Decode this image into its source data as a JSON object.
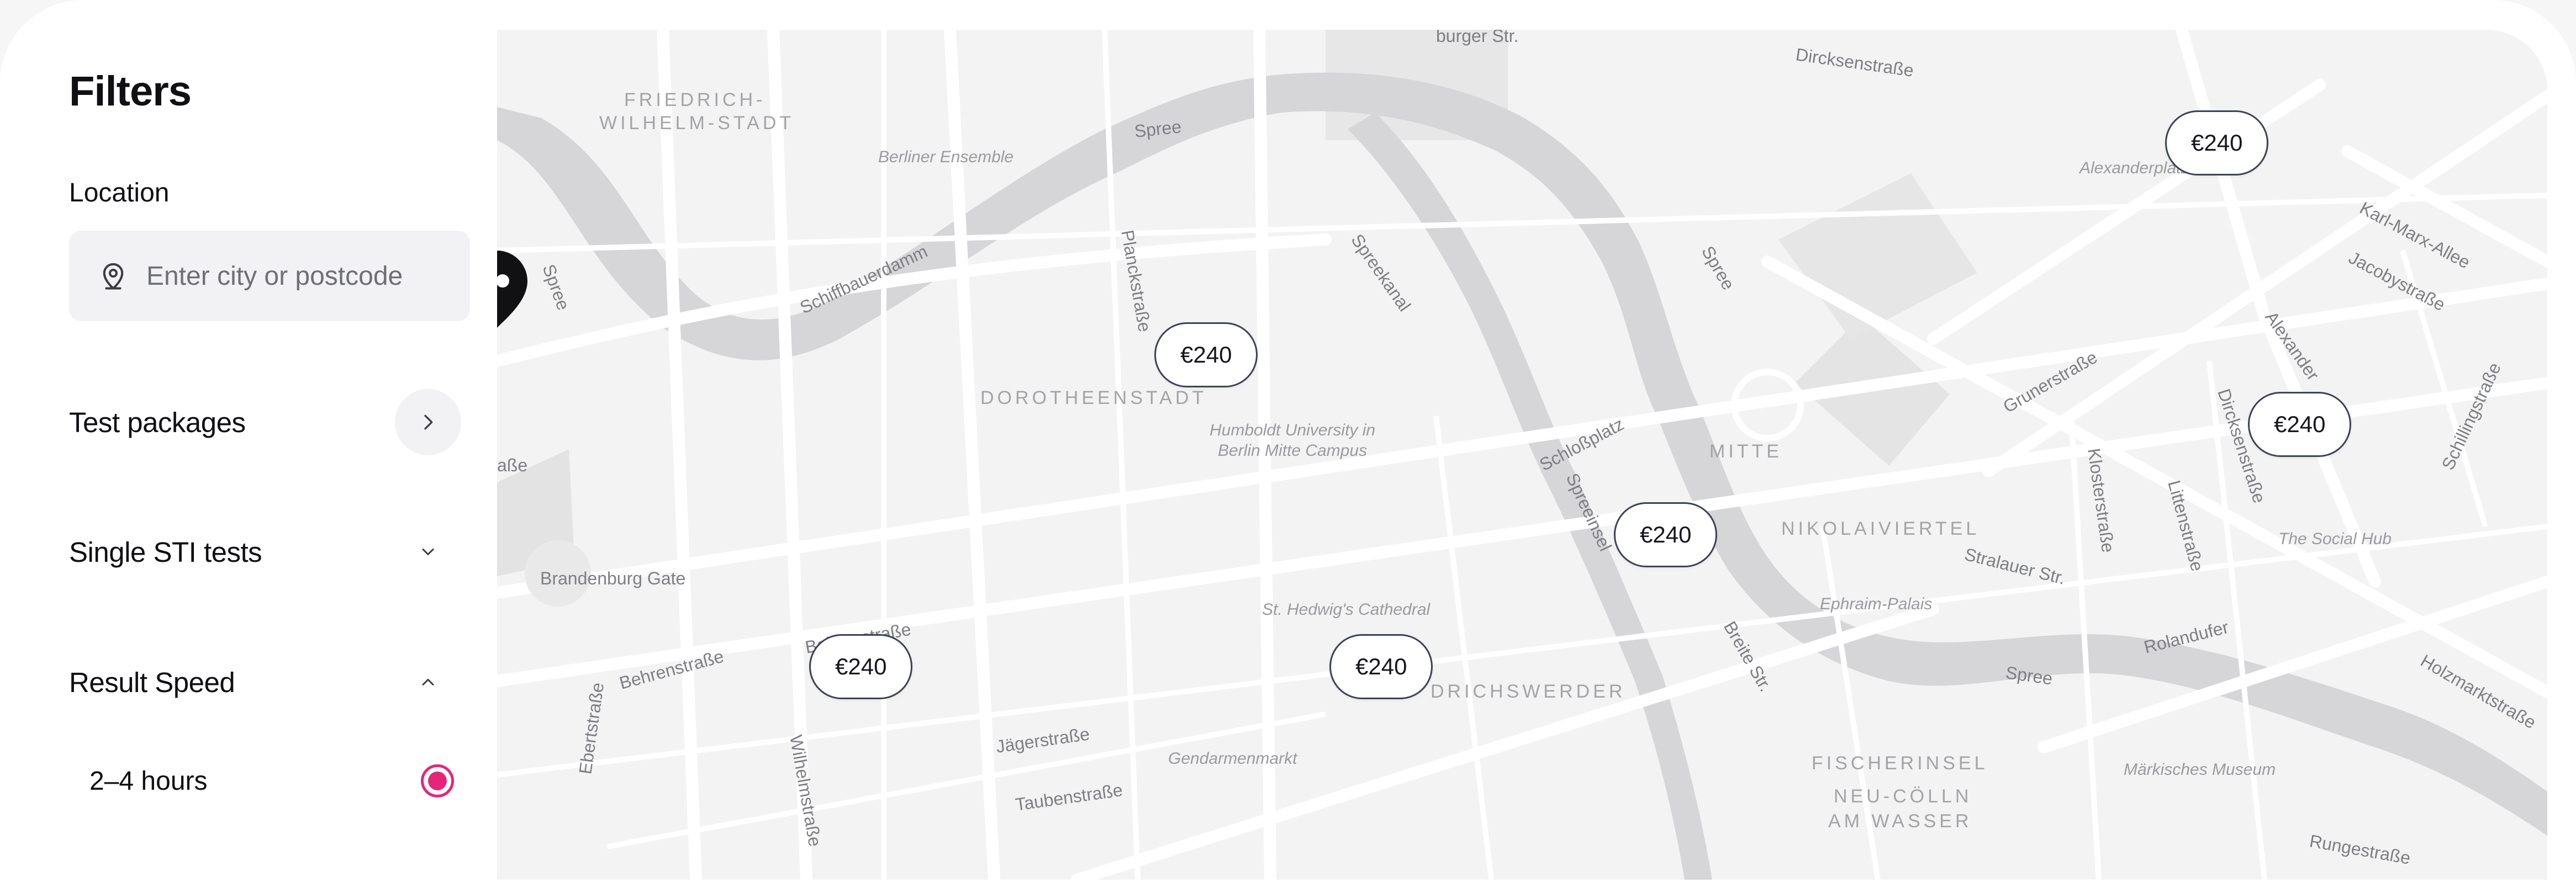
{
  "filters": {
    "title": "Filters",
    "location": {
      "label": "Location",
      "placeholder": "Enter city or postcode",
      "value": ""
    },
    "sections": {
      "packages": "Test packages",
      "single": "Single STI tests",
      "speed": "Result Speed"
    },
    "speed_options": [
      {
        "label": "2–4 hours",
        "selected": true
      }
    ]
  },
  "map": {
    "markers": [
      "€240",
      "€240",
      "€240",
      "€240",
      "€240",
      "€240"
    ],
    "districts": [
      "FRIEDRICH-",
      "WILHELM-STADT",
      "DOROTHEENSTADT",
      "MITTE",
      "NIKOLAIVIERTEL",
      "FISCHERINSEL",
      "NEU-CÖLLN",
      "AM WASSER",
      "DRICHSWERDER"
    ],
    "streets": [
      "burger Str.",
      "Dircksenstraße",
      "Spree",
      "Spree",
      "Spree",
      "Spree",
      "Schiffbauerdamm",
      "Planckstraße",
      "Spreekanal",
      "Karl-Marx-Allee",
      "Jacobystraße",
      "Alexanderplatz",
      "Alexander",
      "Grunerstraße",
      "Dircksenstraße",
      "Schillingstraße",
      "Klosterstraße",
      "Littenstraße",
      "Schloßplatz",
      "Spreeinsel",
      "Stralauer Str.",
      "Breite Str.",
      "Rolandufer",
      "Holzmarktstraße",
      "Behrenstraße",
      "Behrenstraße",
      "Ebertstraße",
      "Wilhelmstraße",
      "Jägerstraße",
      "Taubenstraße",
      "Rungestraße",
      "aße",
      "Brandenburg Gate"
    ],
    "pois": [
      "Berliner Ensemble",
      "Humboldt University in",
      "Berlin Mitte Campus",
      "St. Hedwig's Cathedral",
      "Gendarmenmarkt",
      "Ephraim-Palais",
      "The Social Hub",
      "Märkisches Museum"
    ]
  },
  "colors": {
    "accent": "#e5257a",
    "marker_border": "#3d4254",
    "map_bg": "#f3f3f3",
    "water": "#d4d4d6"
  },
  "icons": {
    "location": "map-pin-icon",
    "packages": "chevron-right-icon",
    "single": "chevron-down-icon",
    "speed": "chevron-up-icon"
  }
}
